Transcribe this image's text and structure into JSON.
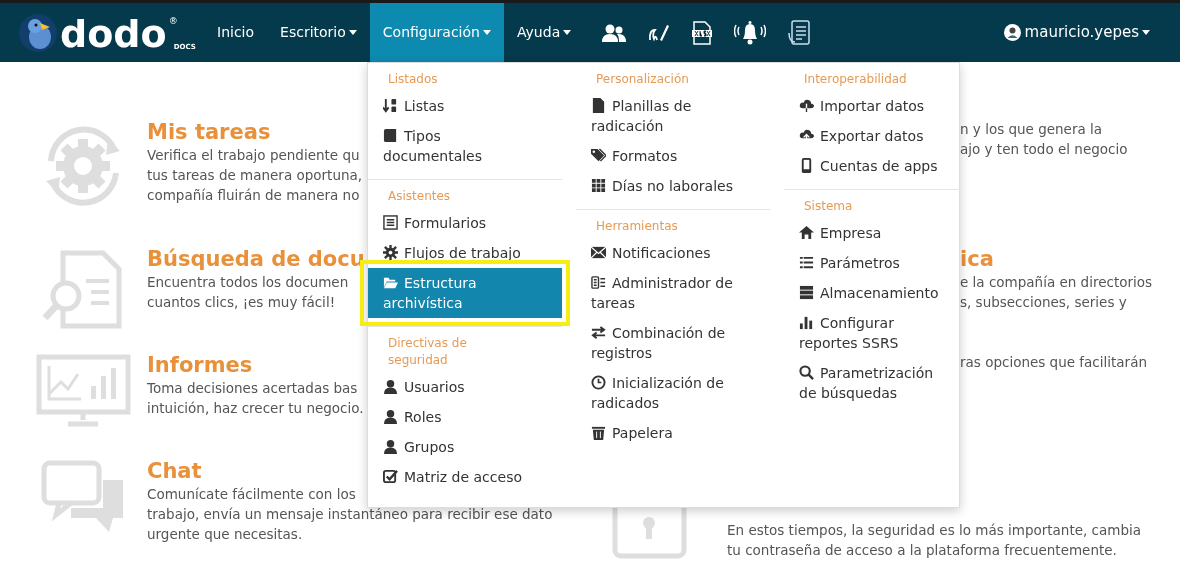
{
  "logo": {
    "text": "dodo",
    "mark": "®",
    "sub": "DOCS"
  },
  "nav": [
    {
      "label": "Inicio",
      "caret": false,
      "selected": false
    },
    {
      "label": "Escritorio",
      "caret": true,
      "selected": false
    },
    {
      "label": "Configuración",
      "caret": true,
      "selected": true
    },
    {
      "label": "Ayuda",
      "caret": true,
      "selected": false
    }
  ],
  "user": {
    "name": "mauricio.yepes"
  },
  "menu": {
    "columns": [
      {
        "sections": [
          {
            "title": "Listados",
            "items": [
              {
                "label": "Listas",
                "selected": false,
                "highlighted": false
              },
              {
                "label": "Tipos documentales",
                "selected": false,
                "highlighted": false
              }
            ]
          },
          {
            "title": "Asistentes",
            "items": [
              {
                "label": "Formularios",
                "selected": false,
                "highlighted": false
              },
              {
                "label": "Flujos de trabajo",
                "selected": false,
                "highlighted": false
              },
              {
                "label": "Estructura archivística",
                "selected": true,
                "highlighted": true
              }
            ]
          },
          {
            "title": "Directivas de seguridad",
            "items": [
              {
                "label": "Usuarios",
                "selected": false,
                "highlighted": false
              },
              {
                "label": "Roles",
                "selected": false,
                "highlighted": false
              },
              {
                "label": "Grupos",
                "selected": false,
                "highlighted": false
              },
              {
                "label": "Matriz de acceso",
                "selected": false,
                "highlighted": false
              }
            ]
          }
        ]
      },
      {
        "sections": [
          {
            "title": "Personalización",
            "items": [
              {
                "label": "Planillas de radicación",
                "selected": false,
                "highlighted": false
              },
              {
                "label": "Formatos",
                "selected": false,
                "highlighted": false
              },
              {
                "label": "Días no laborales",
                "selected": false,
                "highlighted": false
              }
            ]
          },
          {
            "title": "Herramientas",
            "items": [
              {
                "label": "Notificaciones",
                "selected": false,
                "highlighted": false
              },
              {
                "label": "Administrador de tareas",
                "selected": false,
                "highlighted": false
              },
              {
                "label": "Combinación de registros",
                "selected": false,
                "highlighted": false
              },
              {
                "label": "Inicialización de radicados",
                "selected": false,
                "highlighted": false
              },
              {
                "label": "Papelera",
                "selected": false,
                "highlighted": false
              }
            ]
          }
        ]
      },
      {
        "sections": [
          {
            "title": "Interoperabilidad",
            "items": [
              {
                "label": "Importar datos",
                "selected": false,
                "highlighted": false
              },
              {
                "label": "Exportar datos",
                "selected": false,
                "highlighted": false
              },
              {
                "label": "Cuentas de apps",
                "selected": false,
                "highlighted": false
              }
            ]
          },
          {
            "title": "Sistema",
            "items": [
              {
                "label": "Empresa",
                "selected": false,
                "highlighted": false
              },
              {
                "label": "Parámetros",
                "selected": false,
                "highlighted": false
              },
              {
                "label": "Almacenamiento",
                "selected": false,
                "highlighted": false
              },
              {
                "label": "Configurar reportes SSRS",
                "selected": false,
                "highlighted": false
              },
              {
                "label": "Parametrización de búsquedas",
                "selected": false,
                "highlighted": false
              }
            ]
          }
        ]
      }
    ]
  },
  "cards_left": [
    {
      "title": "Mis tareas",
      "lines": [
        "Verifica el trabajo pendiente qu",
        "tus tareas de manera oportuna,",
        "compañía fluirán de manera no"
      ]
    },
    {
      "title": "Búsqueda de docu",
      "lines": [
        "Encuentra todos los documen",
        "cuantos clics, ¡es muy fácil!"
      ]
    },
    {
      "title": "Informes",
      "lines": [
        "Toma decisiones acertadas bas",
        "intuición, haz crecer tu negocio."
      ]
    },
    {
      "title": "Chat",
      "lines": [
        "Comunícate fácilmente con los",
        "trabajo, envía un mensaje instantáneo para recibir ese dato",
        "urgente que necesitas."
      ]
    }
  ],
  "cards_right": [
    {
      "lines": [
        "n y los que genera la",
        "ajo y ten todo el negocio"
      ]
    },
    {
      "title": "ica",
      "lines": [
        "e la compañía en directorios",
        "s, subsecciones, series y"
      ]
    },
    {
      "lines": [
        "ras opciones que facilitarán"
      ]
    },
    {
      "lines": [
        "En estos tiempos, la seguridad es lo más importante, cambia",
        "tu contraseña de acceso a la plataforma frecuentemente."
      ]
    }
  ]
}
